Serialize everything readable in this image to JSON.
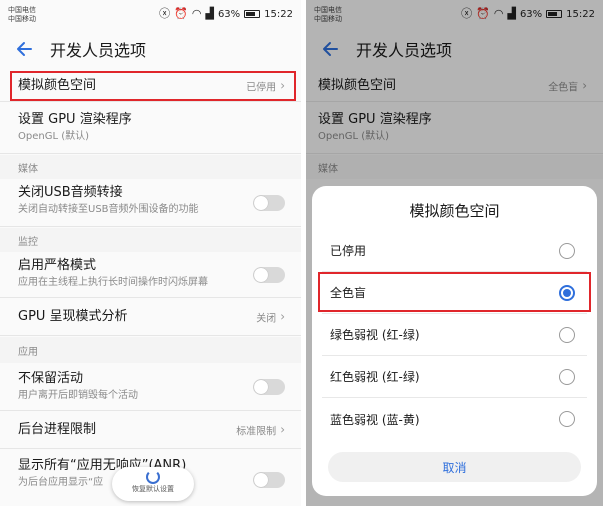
{
  "status": {
    "carrier1": "中国电信",
    "carrier2": "中国移动",
    "battery": "63%",
    "battery_level": 0.63,
    "time": "15:22"
  },
  "page_title": "开发人员选项",
  "left": {
    "color_space": {
      "label": "模拟颜色空间",
      "value": "已停用"
    },
    "gpu_renderer": {
      "label": "设置 GPU 渲染程序",
      "sub": "OpenGL (默认)"
    },
    "section_media": "媒体",
    "usb_audio": {
      "label": "关闭USB音频转接",
      "sub": "关闭自动转接至USB音频外围设备的功能"
    },
    "section_monitor": "监控",
    "strict_mode": {
      "label": "启用严格模式",
      "sub": "应用在主线程上执行长时间操作时闪烁屏幕"
    },
    "gpu_profile": {
      "label": "GPU 呈现模式分析",
      "value": "关闭"
    },
    "section_apps": "应用",
    "dont_keep": {
      "label": "不保留活动",
      "sub": "用户离开后即销毁每个活动"
    },
    "bg_limit": {
      "label": "后台进程限制",
      "value": "标准限制"
    },
    "anr": {
      "label": "显示所有“应用无响应”(ANR)",
      "sub": "为后台应用显示“应"
    },
    "restore": "恢复默认设置"
  },
  "right": {
    "color_space": {
      "label": "模拟颜色空间",
      "value": "全色盲"
    },
    "gpu_renderer": {
      "label": "设置 GPU 渲染程序",
      "sub": "OpenGL (默认)"
    },
    "section_media": "媒体",
    "dialog": {
      "title": "模拟颜色空间",
      "options": [
        {
          "label": "已停用",
          "checked": false
        },
        {
          "label": "全色盲",
          "checked": true
        },
        {
          "label": "绿色弱视 (红-绿)",
          "checked": false
        },
        {
          "label": "红色弱视 (红-绿)",
          "checked": false
        },
        {
          "label": "蓝色弱视 (蓝-黄)",
          "checked": false
        }
      ],
      "cancel": "取消"
    }
  },
  "colors": {
    "accent": "#2f6fdc",
    "highlight": "#e0262b"
  },
  "icons": [
    "back-arrow-icon",
    "mute-icon",
    "alarm-icon",
    "wifi-icon",
    "signal-icon",
    "battery-icon",
    "chevron-right-icon",
    "restore-icon",
    "radio-icon"
  ]
}
